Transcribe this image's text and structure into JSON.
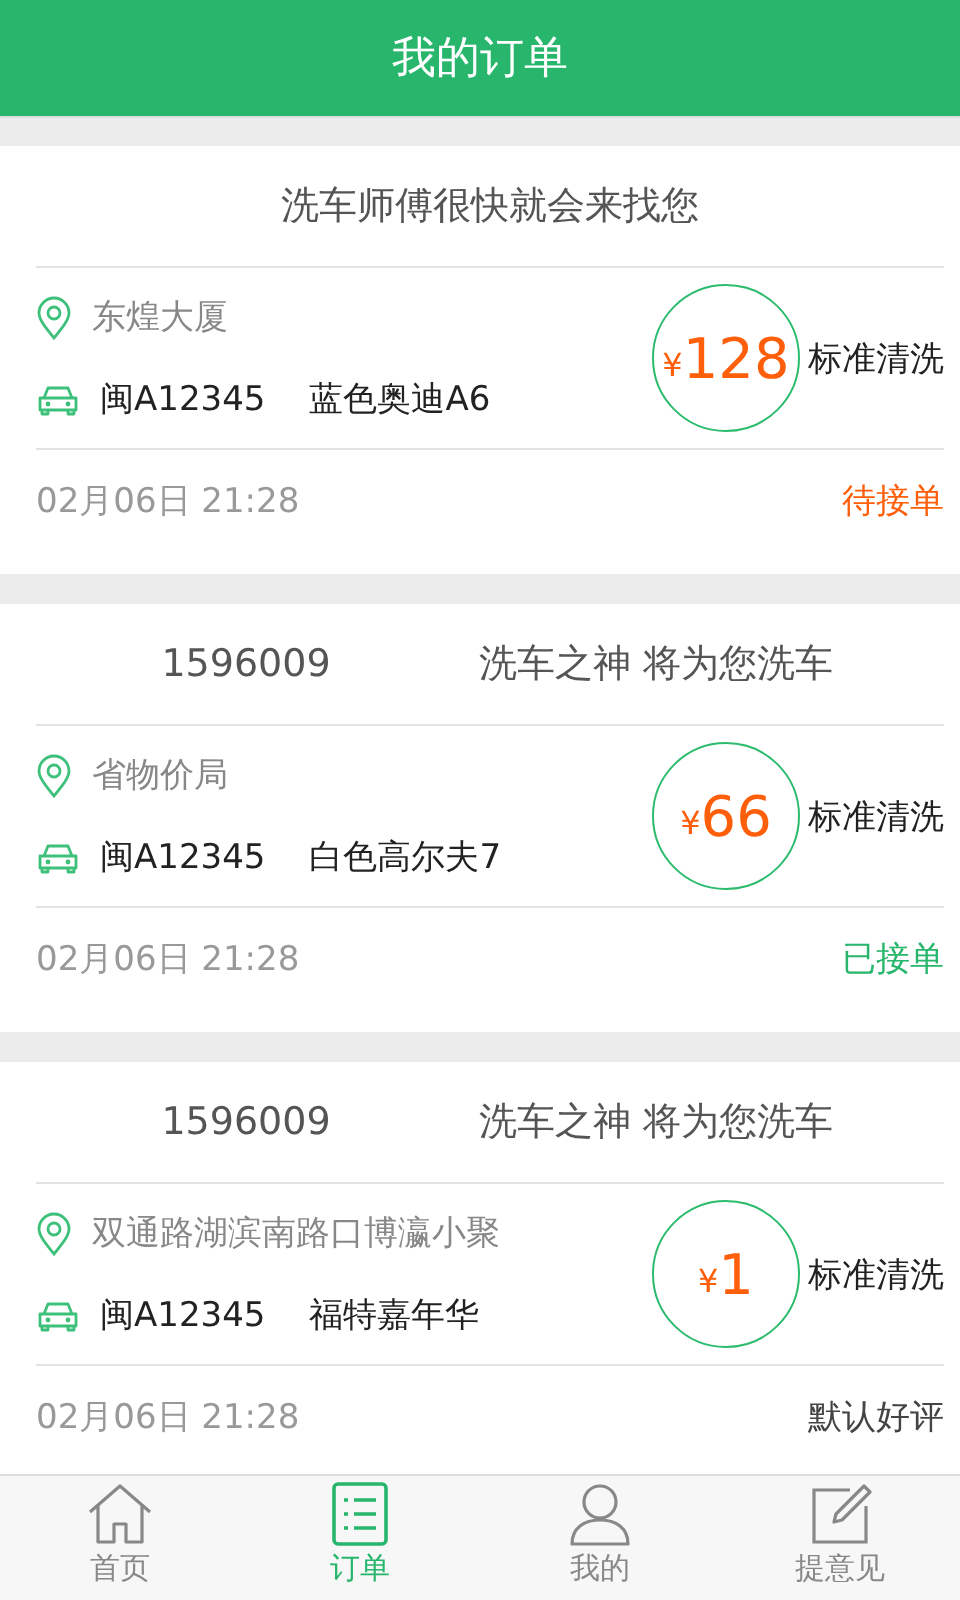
{
  "top_bar": {
    "title": "我的订单"
  },
  "orders": [
    {
      "message": "洗车师傅很快就会来找您",
      "location": "东煌大厦",
      "plate": "闽A12345",
      "car": "蓝色奥迪A6",
      "currency": "¥",
      "price": "128",
      "service": "标准清洗",
      "time": "02月06日 21:28",
      "status": "待接单",
      "color": "#ff5f0a"
    },
    {
      "number": "1596009",
      "message": "洗车之神 将为您洗车",
      "location": "省物价局",
      "plate": "闽A12345",
      "car": "白色高尔夫7",
      "currency": "¥",
      "price": "66",
      "service": "标准清洗",
      "time": "02月06日 21:28",
      "status": "已接单",
      "color": "#27b66c"
    },
    {
      "number": "1596009",
      "message": "洗车之神 将为您洗车",
      "location": "双通路湖滨南路口博瀛小聚",
      "plate": "闽A12345",
      "car": "福特嘉年华",
      "currency": "¥",
      "price": "1",
      "service": "标准清洗",
      "time": "02月06日 21:28",
      "status": "默认好评",
      "color": "#444444"
    }
  ],
  "tabs": [
    {
      "label": "首页",
      "selected": false
    },
    {
      "label": "订单",
      "selected": true
    },
    {
      "label": "我的",
      "selected": false
    },
    {
      "label": "提意见",
      "selected": false
    }
  ]
}
